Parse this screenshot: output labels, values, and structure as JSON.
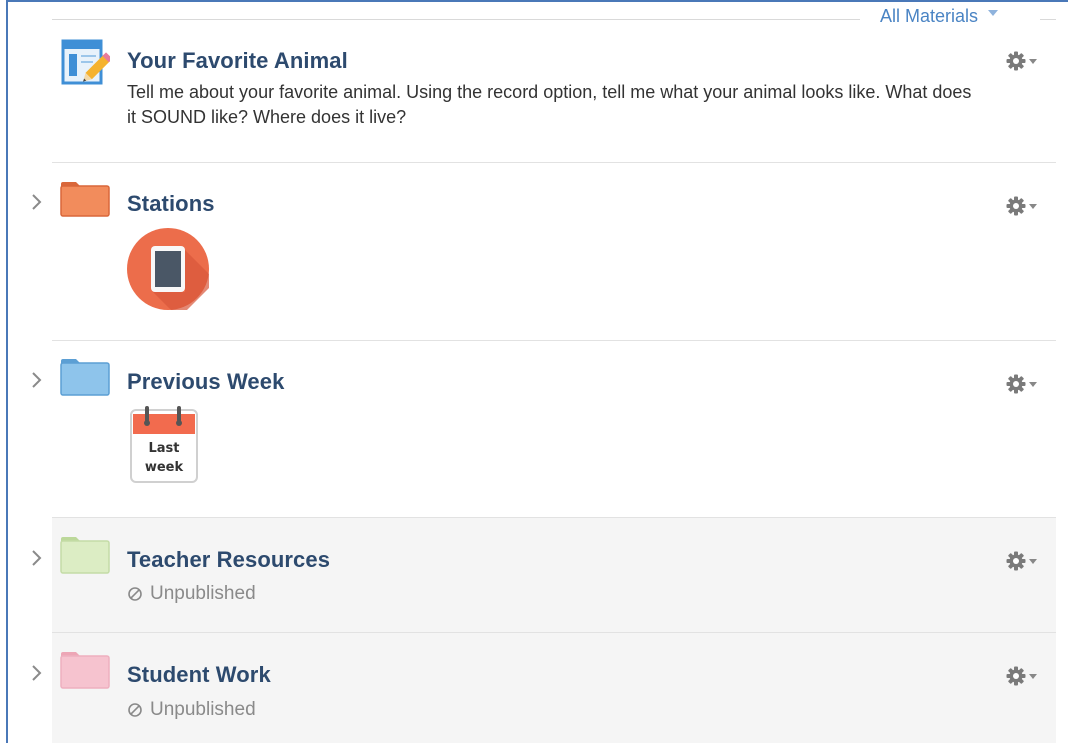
{
  "header": {
    "filter_label": "All Materials"
  },
  "items": [
    {
      "type": "assignment",
      "title": "Your Favorite Animal",
      "description": "Tell me about your favorite animal. Using the record option, tell me what your animal looks like. What does it SOUND like? Where does it live?"
    },
    {
      "type": "folder",
      "title": "Stations",
      "folder_color": "#f28c5c",
      "thumbnail": "tablet-icon"
    },
    {
      "type": "folder",
      "title": "Previous Week",
      "folder_color": "#7fb6e0",
      "thumbnail": "calendar-icon",
      "thumbnail_text": [
        "Last",
        "week"
      ]
    },
    {
      "type": "folder",
      "title": "Teacher Resources",
      "folder_color": "#d6e8b6",
      "status": "Unpublished"
    },
    {
      "type": "folder",
      "title": "Student Work",
      "folder_color": "#f4bfcb",
      "status": "Unpublished"
    }
  ]
}
